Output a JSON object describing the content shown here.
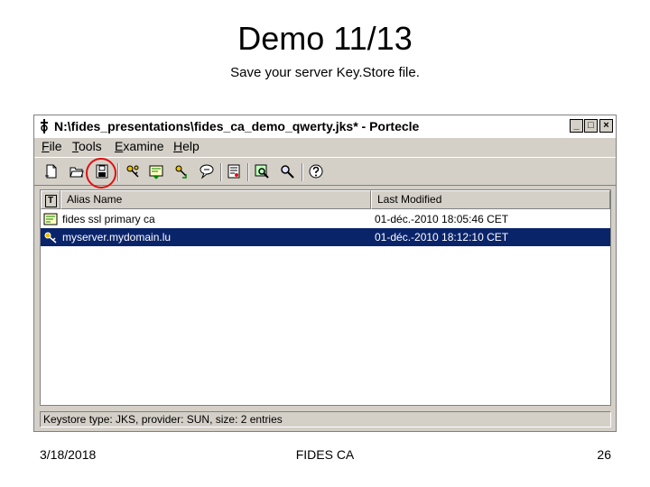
{
  "slide": {
    "title": "Demo 11/13",
    "subtitle": "Save your server Key.Store file."
  },
  "window": {
    "title": "N:\\fides_presentations\\fides_ca_demo_qwerty.jks* - Portecle",
    "controls": {
      "minimize": "_",
      "maximize": "□",
      "close": "×"
    }
  },
  "menu": {
    "file": {
      "key": "F",
      "rest": "ile"
    },
    "tools": {
      "key": "T",
      "rest": "ools"
    },
    "examine": {
      "key": "E",
      "rest": "xamine"
    },
    "help": {
      "key": "H",
      "rest": "elp"
    }
  },
  "toolbar": {
    "buttons": [
      "new-keystore-icon",
      "open-keystore-icon",
      "save-keystore-icon",
      "generate-keypair-icon",
      "import-certificate-icon",
      "import-keypair-icon",
      "set-password-icon",
      "examine-certificate-icon",
      "examine-crl-icon",
      "examine-ssl-icon",
      "help-icon"
    ],
    "highlight_color": "#e01010"
  },
  "table": {
    "columns": {
      "type": "T",
      "alias": "Alias Name",
      "modified": "Last Modified"
    },
    "rows": [
      {
        "icon": "certificate-icon",
        "alias": "fides ssl primary ca",
        "modified": "01-déc.-2010 18:05:46 CET",
        "selected": false
      },
      {
        "icon": "keypair-icon",
        "alias": "myserver.mydomain.lu",
        "modified": "01-déc.-2010 18:12:10 CET",
        "selected": true
      }
    ],
    "selection_color": "#0a246a"
  },
  "status": "Keystore type: JKS, provider: SUN, size: 2 entries",
  "footer": {
    "date": "3/18/2018",
    "center": "FIDES CA",
    "page": "26"
  }
}
